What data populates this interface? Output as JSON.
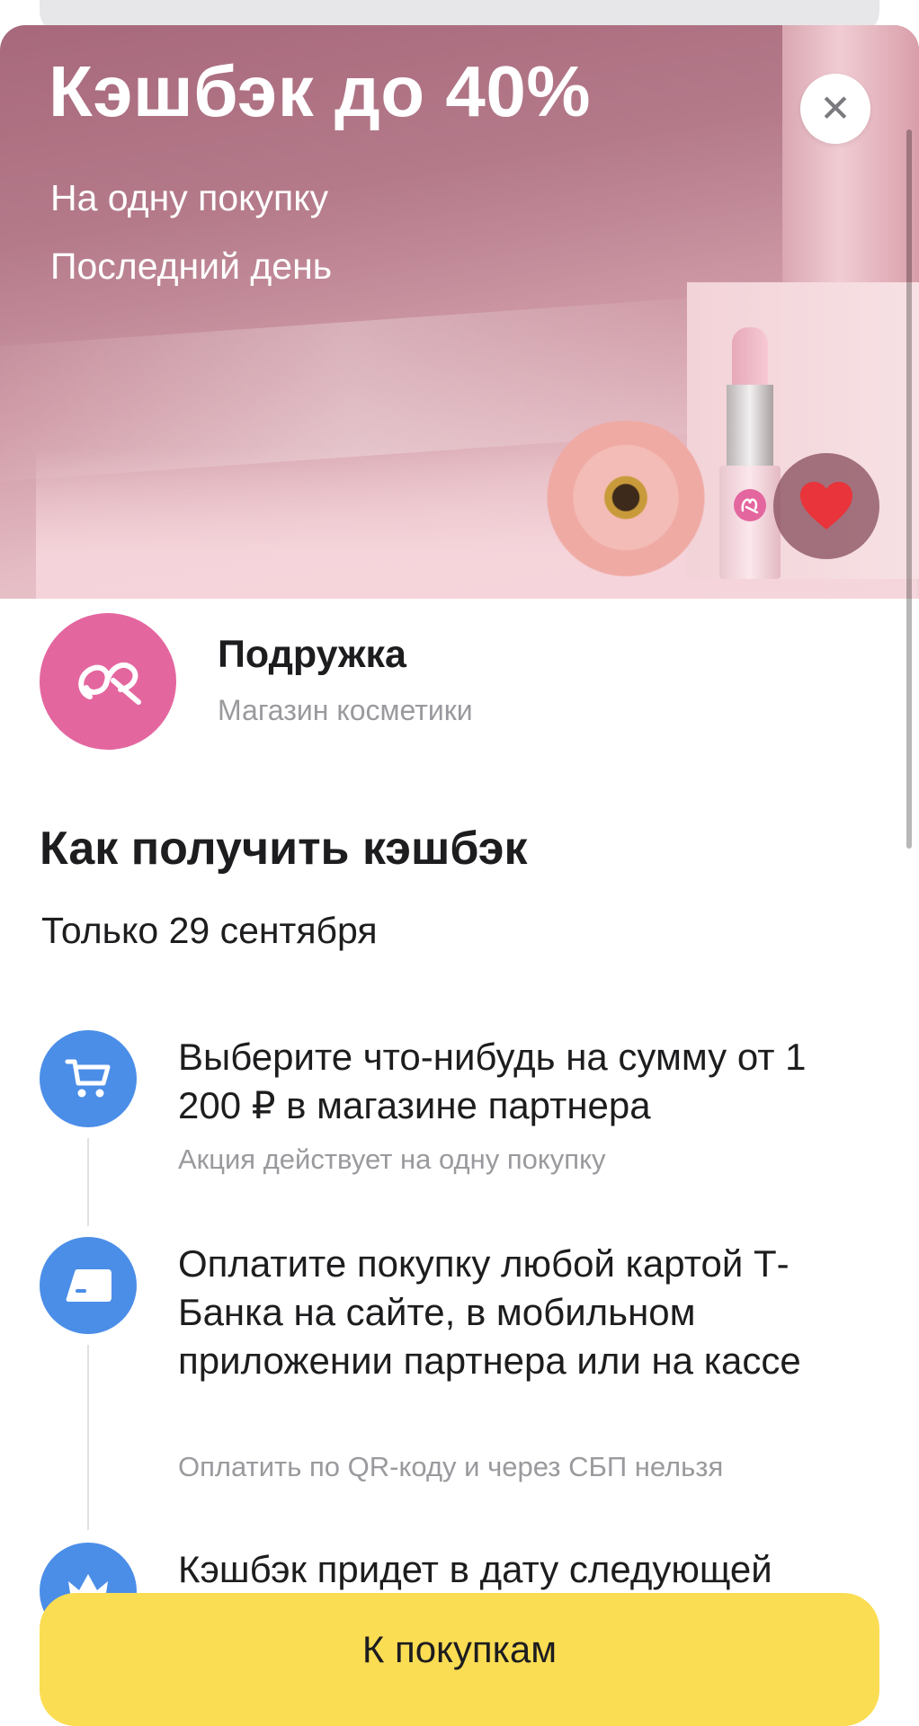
{
  "hero": {
    "title": "Кэшбэк до 40%",
    "subtitle_1": "На одну покупку",
    "subtitle_2": "Последний день",
    "close_symbol": "✕"
  },
  "shop": {
    "name": "Подружка",
    "description": "Магазин косметики",
    "logo_color": "#e4669f"
  },
  "section": {
    "title": "Как получить кэшбэк",
    "date": "Только 29 сентября"
  },
  "steps": [
    {
      "icon": "cart-icon",
      "text": "Выберите что-нибудь на сумму от 1 200 ₽ в магазине партнера",
      "note": "Акция действует на одну покупку"
    },
    {
      "icon": "card-icon",
      "text": "Оплатите покупку любой картой Т-Банка на сайте, в мобильном приложении партнера или на кассе",
      "note": "Оплатить по QR-коду и через СБП нельзя"
    },
    {
      "icon": "star-icon",
      "text": "Кэшбэк придет в дату следующей"
    }
  ],
  "cta": {
    "label": "К покупкам"
  },
  "colors": {
    "accent_blue": "#4b8ee8",
    "cta_yellow": "#fbdd53",
    "heart_red": "#e8343a"
  }
}
